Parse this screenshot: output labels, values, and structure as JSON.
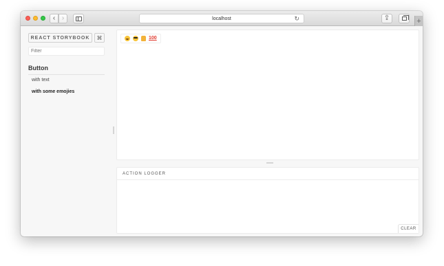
{
  "browser": {
    "url": "localhost",
    "back_glyph": "‹",
    "forward_glyph": "›",
    "reload_glyph": "↻",
    "share_glyph": "⇪",
    "new_tab_glyph": "+",
    "icons": [
      "back-icon",
      "forward-icon",
      "sidebar-toggle-icon",
      "reload-icon",
      "share-icon",
      "tabs-icon",
      "new-tab-icon"
    ]
  },
  "storybook": {
    "title": "REACT STORYBOOK",
    "shortcut": "⌘",
    "filter_placeholder": "Filter",
    "kind": "Button",
    "stories": [
      "with text",
      "with some emojies"
    ]
  },
  "preview": {
    "emojis": [
      "grinning-face",
      "smiling-face-with-sunglasses",
      "thumbs-up",
      "hundred-points"
    ],
    "hundred_label": "100"
  },
  "action_logger": {
    "title": "ACTION LOGGER",
    "clear_label": "CLEAR"
  }
}
